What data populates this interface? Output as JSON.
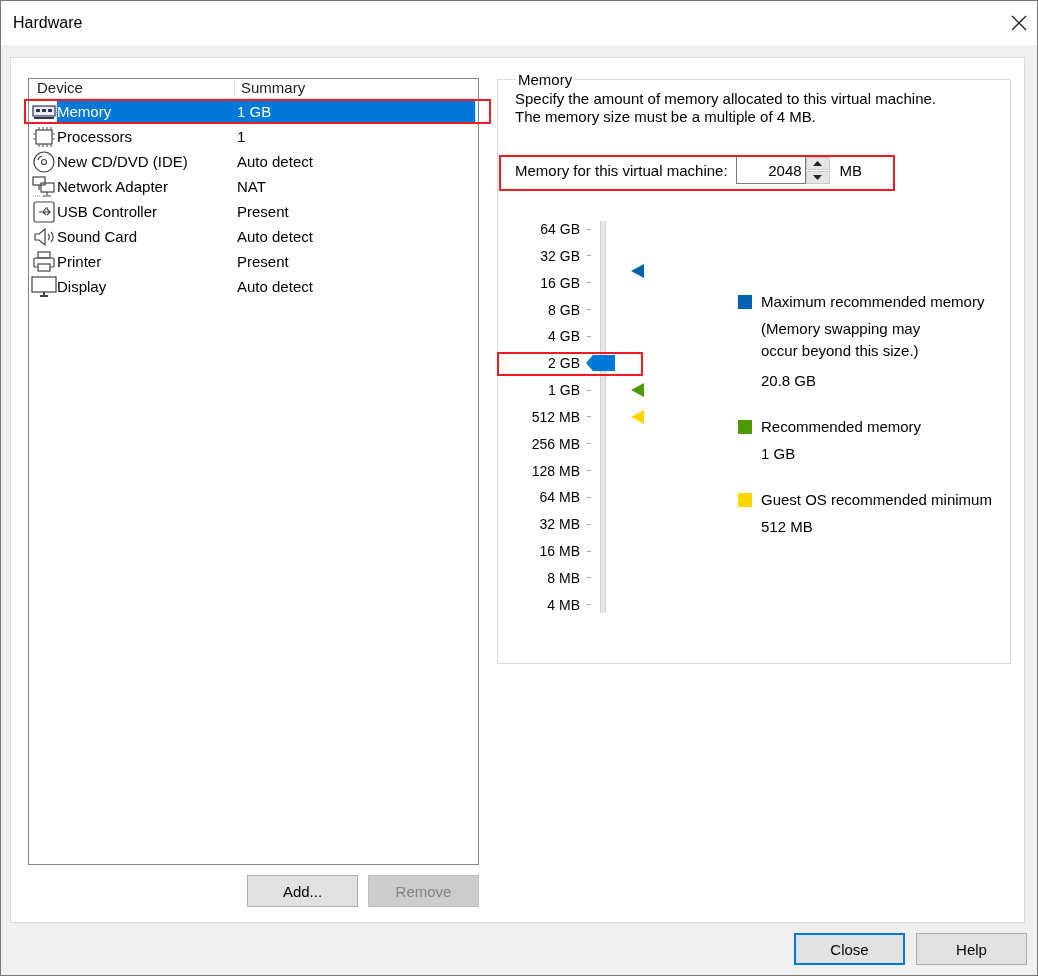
{
  "window": {
    "title": "Hardware"
  },
  "devices": {
    "columns": [
      "Device",
      "Summary"
    ],
    "rows": [
      {
        "kind": "memory",
        "name": "Memory",
        "summary": "1 GB",
        "selected": true
      },
      {
        "kind": "processor",
        "name": "Processors",
        "summary": "1",
        "selected": false
      },
      {
        "kind": "disc",
        "name": "New CD/DVD (IDE)",
        "summary": "Auto detect",
        "selected": false
      },
      {
        "kind": "network",
        "name": "Network Adapter",
        "summary": "NAT",
        "selected": false
      },
      {
        "kind": "usb",
        "name": "USB Controller",
        "summary": "Present",
        "selected": false
      },
      {
        "kind": "sound",
        "name": "Sound Card",
        "summary": "Auto detect",
        "selected": false
      },
      {
        "kind": "printer",
        "name": "Printer",
        "summary": "Present",
        "selected": false
      },
      {
        "kind": "display",
        "name": "Display",
        "summary": "Auto detect",
        "selected": false
      }
    ]
  },
  "actions": [
    {
      "label": "Add...",
      "disabled": false
    },
    {
      "label": "Remove",
      "disabled": true
    }
  ],
  "memory": {
    "title": "Memory",
    "description": "Specify the amount of memory allocated to this virtual machine.\nThe memory size must be a multiple of 4 MB.",
    "field": {
      "label": "Memory for this virtual machine:",
      "value": "2048",
      "unit": "MB"
    },
    "slider": {
      "ticks": [
        "64 GB",
        "32 GB",
        "16 GB",
        "8 GB",
        "4 GB",
        "2 GB",
        "1 GB",
        "512 MB",
        "256 MB",
        "128 MB",
        "64 MB",
        "32 MB",
        "16 MB",
        "8 MB",
        "4 MB"
      ],
      "level": 0.643,
      "markers": [
        {
          "color": "#0063b1",
          "level": 0.889
        },
        {
          "color": "#4e9a06",
          "level": 0.571
        },
        {
          "color": "#ffd700",
          "level": 0.5
        }
      ]
    },
    "legend": [
      {
        "color": "#0063b1",
        "title": "Maximum recommended memory",
        "note": "(Memory swapping may\noccur beyond this size.)",
        "value": "20.8 GB"
      },
      {
        "color": "#4e9a06",
        "title": "Recommended memory",
        "value": "1 GB"
      },
      {
        "color": "#ffd700",
        "title": "Guest OS recommended minimum",
        "value": "512 MB"
      }
    ]
  },
  "buttons": [
    {
      "label": "Close",
      "default": true
    },
    {
      "label": "Help",
      "default": false
    }
  ]
}
